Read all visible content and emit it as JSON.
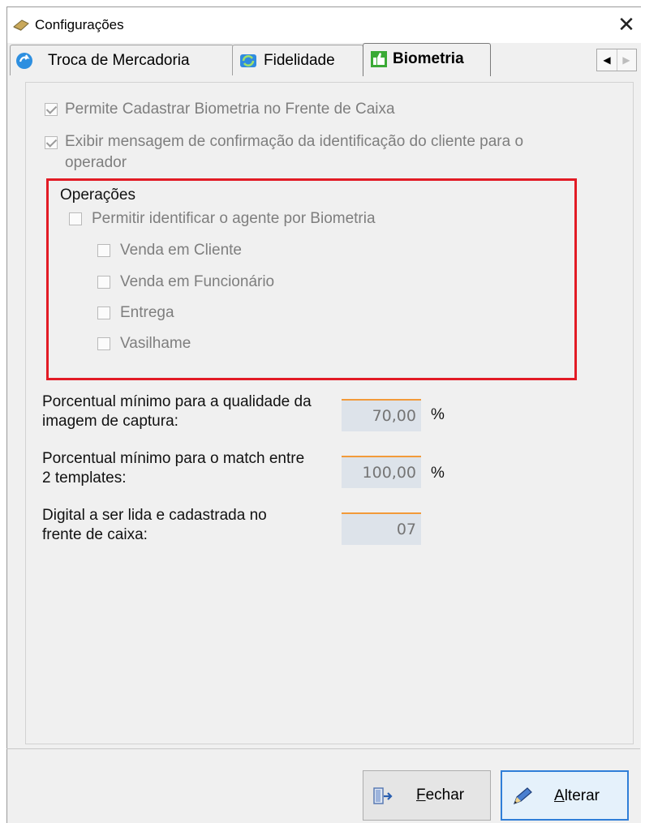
{
  "window": {
    "title": "Configurações",
    "close_glyph": "✕",
    "title_icon": "settings-icon"
  },
  "tabs": [
    {
      "label": "Troca de Mercadoria",
      "icon": "exchange-icon"
    },
    {
      "label": "Fidelidade",
      "icon": "refresh-icon"
    },
    {
      "label": "Biometria",
      "icon": "biometry-icon",
      "active": true
    }
  ],
  "tab_scroll": {
    "left": "◀",
    "right": "▶"
  },
  "options": {
    "permite_cadastrar": {
      "label": "Permite Cadastrar Biometria no Frente de Caixa",
      "checked": true
    },
    "exibir_mensagem": {
      "label_line1": "Exibir mensagem de confirmação da identificação do cliente para o",
      "label_line2": "operador",
      "checked": true
    }
  },
  "operacoes": {
    "title": "Operações",
    "permitir": {
      "label": "Permitir identificar o agente por Biometria",
      "checked": false
    },
    "items": [
      {
        "label": "Venda em Cliente",
        "checked": false
      },
      {
        "label": "Venda em Funcionário",
        "checked": false
      },
      {
        "label": "Entrega",
        "checked": false
      },
      {
        "label": "Vasilhame",
        "checked": false
      }
    ]
  },
  "fields": [
    {
      "label_line1": "Porcentual mínimo para a qualidade da",
      "label_line2": "imagem de captura:",
      "value": "70,00",
      "unit": "%"
    },
    {
      "label_line1": "Porcentual mínimo para o match entre",
      "label_line2": "2 templates:",
      "value": "100,00",
      "unit": "%"
    },
    {
      "label_line1": "Digital a ser lida e cadastrada no",
      "label_line2": "frente de caixa:",
      "value": "07",
      "unit": ""
    }
  ],
  "buttons": {
    "fechar": {
      "accel": "F",
      "rest": "echar",
      "icon": "exit-door-icon"
    },
    "alterar": {
      "accel": "A",
      "rest": "lterar",
      "icon": "pencil-icon"
    }
  },
  "colors": {
    "highlight": "#e21b25",
    "field_bg": "#dde3ea",
    "field_accent": "#f29a3a",
    "primary_border": "#2f7ed8"
  }
}
